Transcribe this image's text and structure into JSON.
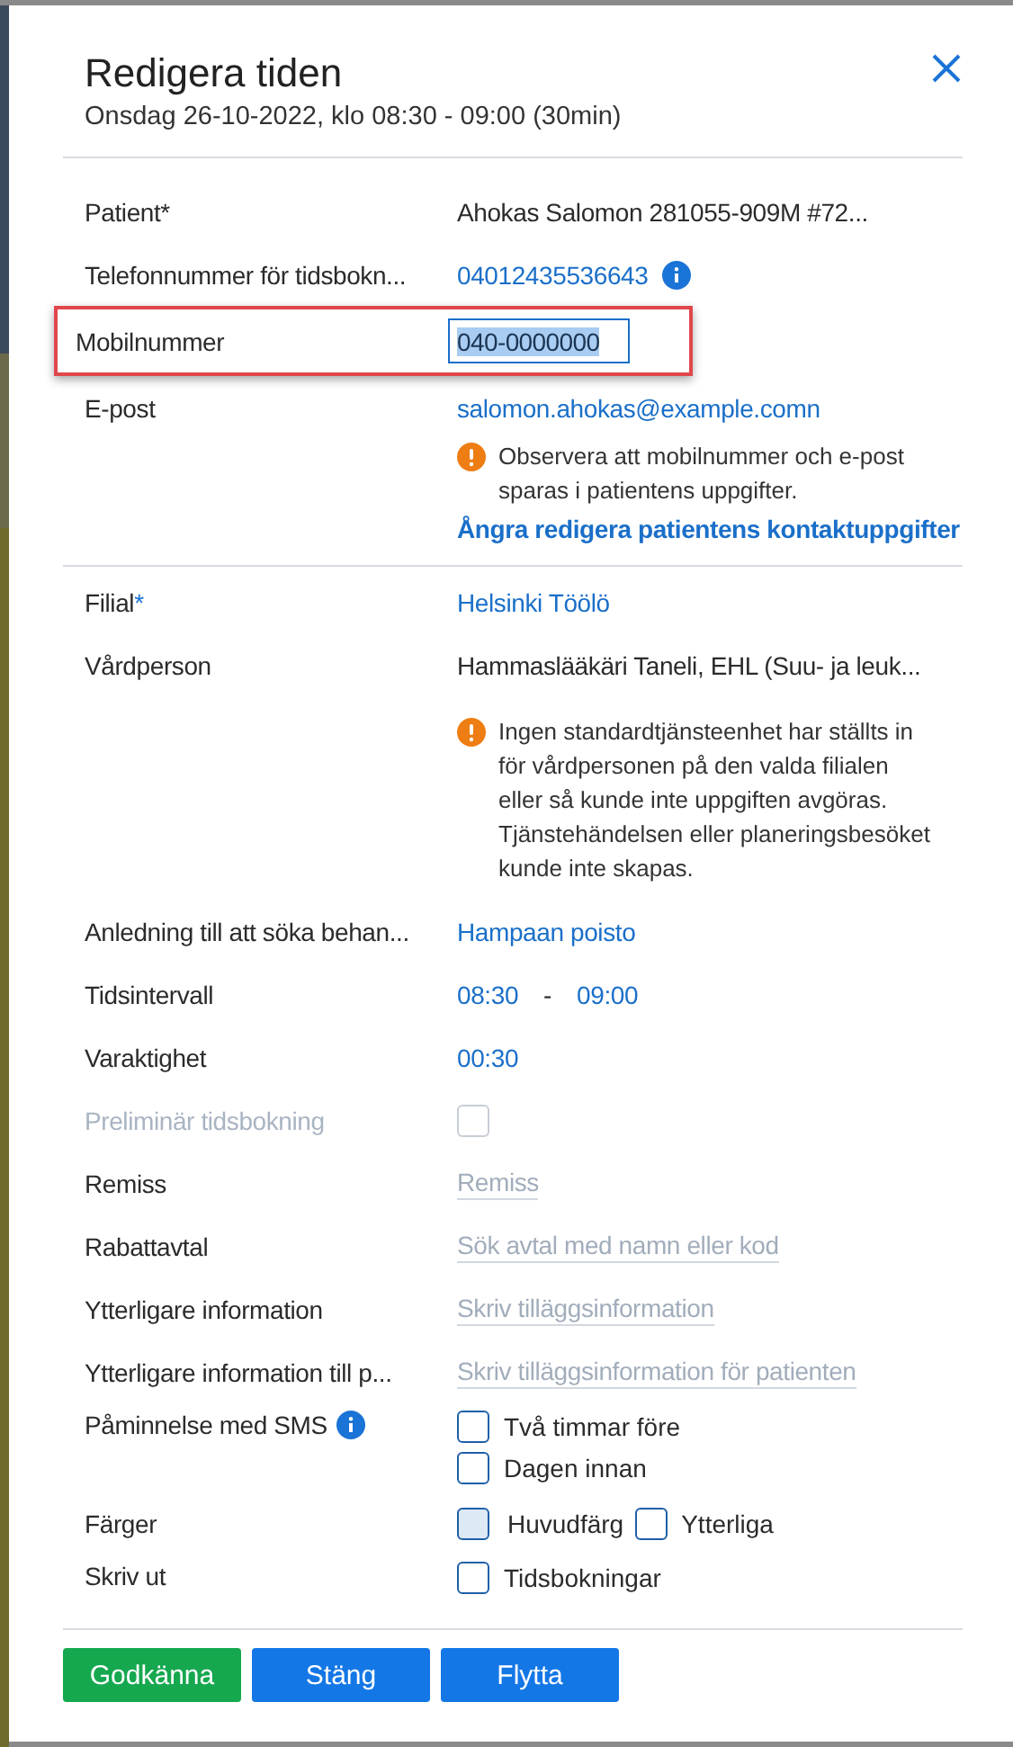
{
  "dialog": {
    "title": "Redigera tiden",
    "subtitle": "Onsdag 26-10-2022, klo 08:30 - 09:00 (30min)"
  },
  "rows": [
    {
      "kind": "text",
      "label": "Patient*",
      "value": "Ahokas Salomon 281055-909M #72..."
    },
    {
      "kind": "link",
      "label": "Telefonnummer för tidsbokn...",
      "value": "04012435536643",
      "info": true
    },
    {
      "kind": "input",
      "label": "Mobilnummer",
      "value": "040-0000000",
      "highlighted": true
    },
    {
      "kind": "link",
      "label": "E-post",
      "value": "salomon.ahokas@example.comn"
    },
    {
      "kind": "note",
      "text": "Observera att mobilnummer och e-post sparas i patientens uppgifter."
    },
    {
      "kind": "action",
      "text": "Ångra redigera patientens kontaktuppgifter"
    },
    {
      "kind": "divider"
    },
    {
      "kind": "link",
      "label": "Filial",
      "required_mark": "*",
      "value": "Helsinki Töölö"
    },
    {
      "kind": "text",
      "label": "Vårdperson",
      "value": "Hammaslääkäri Taneli, EHL (Suu- ja leuk..."
    },
    {
      "kind": "note",
      "text": "Ingen standardtjänsteenhet har ställts in för vårdpersonen på den valda filialen eller så kunde inte uppgiften avgöras. Tjänstehändelsen eller planeringsbesöket kunde inte skapas."
    },
    {
      "kind": "link",
      "label": "Anledning till att söka behan...",
      "value": "Hampaan poisto"
    },
    {
      "kind": "range",
      "label": "Tidsintervall",
      "start": "08:30",
      "separator": "-",
      "end": "09:00"
    },
    {
      "kind": "link",
      "label": "Varaktighet",
      "value": "00:30"
    },
    {
      "kind": "checkbox",
      "label": "Preliminär tidsbokning",
      "checked": false,
      "disabled": true
    },
    {
      "kind": "placeholder",
      "label": "Remiss",
      "placeholder": "Remiss"
    },
    {
      "kind": "placeholder",
      "label": "Rabattavtal",
      "placeholder": "Sök avtal med namn eller kod"
    },
    {
      "kind": "placeholder",
      "label": "Ytterligare information",
      "placeholder": "Skriv tilläggsinformation"
    },
    {
      "kind": "placeholder",
      "label": "Ytterligare information till p...",
      "placeholder": "Skriv tilläggsinformation för patienten"
    },
    {
      "kind": "checks",
      "label": "Påminnelse med SMS",
      "info": true,
      "options": [
        {
          "label": "Två timmar före",
          "checked": false
        },
        {
          "label": "Dagen innan",
          "checked": false
        }
      ]
    },
    {
      "kind": "swatches",
      "label": "Färger",
      "options": [
        {
          "label": "Huvudfärg",
          "checked": false,
          "color": "#dde9f5"
        },
        {
          "label": "Ytterliga",
          "checked": false
        }
      ]
    },
    {
      "kind": "checks",
      "label": "Skriv ut",
      "options": [
        {
          "label": "Tidsbokningar",
          "checked": false
        }
      ]
    }
  ],
  "buttons": [
    {
      "label": "Godkänna",
      "kind": "primary"
    },
    {
      "label": "Stäng",
      "kind": "secondary"
    },
    {
      "label": "Flytta",
      "kind": "secondary"
    }
  ]
}
